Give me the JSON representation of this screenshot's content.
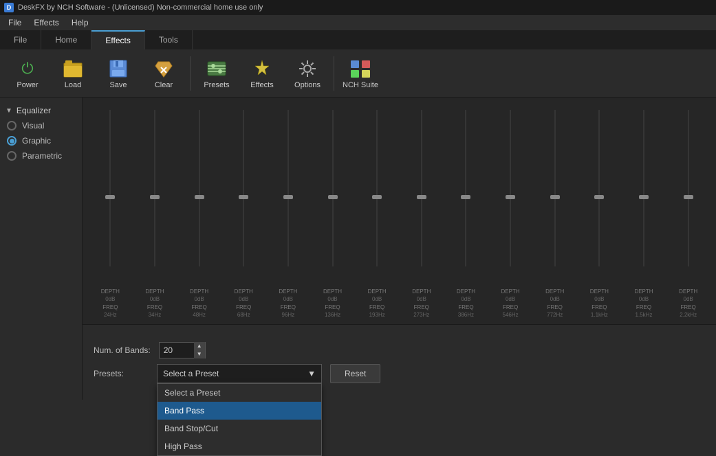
{
  "titlebar": {
    "text": "DeskFX by NCH Software - (Unlicensed) Non-commercial home use only"
  },
  "menubar": {
    "items": [
      "File",
      "Effects",
      "Help"
    ]
  },
  "tabs": [
    {
      "id": "file",
      "label": "File"
    },
    {
      "id": "home",
      "label": "Home"
    },
    {
      "id": "effects",
      "label": "Effects",
      "active": true
    },
    {
      "id": "tools",
      "label": "Tools"
    }
  ],
  "toolbar": {
    "buttons": [
      {
        "id": "power",
        "label": "Power",
        "icon": "⏻"
      },
      {
        "id": "load",
        "label": "Load",
        "icon": "📂"
      },
      {
        "id": "save",
        "label": "Save",
        "icon": "💾"
      },
      {
        "id": "clear",
        "label": "Clear",
        "icon": "🧹"
      },
      {
        "id": "presets",
        "label": "Presets",
        "icon": "🎛"
      },
      {
        "id": "effects",
        "label": "Effects",
        "icon": "✨"
      },
      {
        "id": "options",
        "label": "Options",
        "icon": "🔧"
      },
      {
        "id": "nch-suite",
        "label": "NCH Suite",
        "icon": "⊞"
      }
    ]
  },
  "left_panel": {
    "section_label": "Equalizer",
    "options": [
      {
        "id": "visual",
        "label": "Visual",
        "selected": false
      },
      {
        "id": "graphic",
        "label": "Graphic",
        "selected": true
      },
      {
        "id": "parametric",
        "label": "Parametric",
        "selected": false
      }
    ]
  },
  "eq": {
    "bands": [
      {
        "freq": "24Hz",
        "depth": "0dB"
      },
      {
        "freq": "34Hz",
        "depth": "0dB"
      },
      {
        "freq": "48Hz",
        "depth": "0dB"
      },
      {
        "freq": "68Hz",
        "depth": "0dB"
      },
      {
        "freq": "96Hz",
        "depth": "0dB"
      },
      {
        "freq": "136Hz",
        "depth": "0dB"
      },
      {
        "freq": "193Hz",
        "depth": "0dB"
      },
      {
        "freq": "273Hz",
        "depth": "0dB"
      },
      {
        "freq": "386Hz",
        "depth": "0dB"
      },
      {
        "freq": "546Hz",
        "depth": "0dB"
      },
      {
        "freq": "772Hz",
        "depth": "0dB"
      },
      {
        "freq": "1.1kHz",
        "depth": "0dB"
      },
      {
        "freq": "1.5kHz",
        "depth": "0dB"
      },
      {
        "freq": "2.2kHz",
        "depth": "0dB"
      }
    ]
  },
  "bottom": {
    "num_bands_label": "Num. of Bands:",
    "num_bands_value": "20",
    "presets_label": "Presets:",
    "preset_placeholder": "Select a Preset",
    "preset_selected": "Select a Preset",
    "reset_label": "Reset",
    "dropdown_items": [
      {
        "id": "select-preset",
        "label": "Select a Preset",
        "highlighted": false
      },
      {
        "id": "band-pass",
        "label": "Band Pass",
        "highlighted": true
      },
      {
        "id": "band-stop-cut",
        "label": "Band Stop/Cut",
        "highlighted": false
      },
      {
        "id": "high-pass",
        "label": "High Pass",
        "highlighted": false
      }
    ]
  },
  "colors": {
    "accent": "#4a9fd4",
    "highlight": "#1e5a8e",
    "power_green": "#4caf50"
  }
}
